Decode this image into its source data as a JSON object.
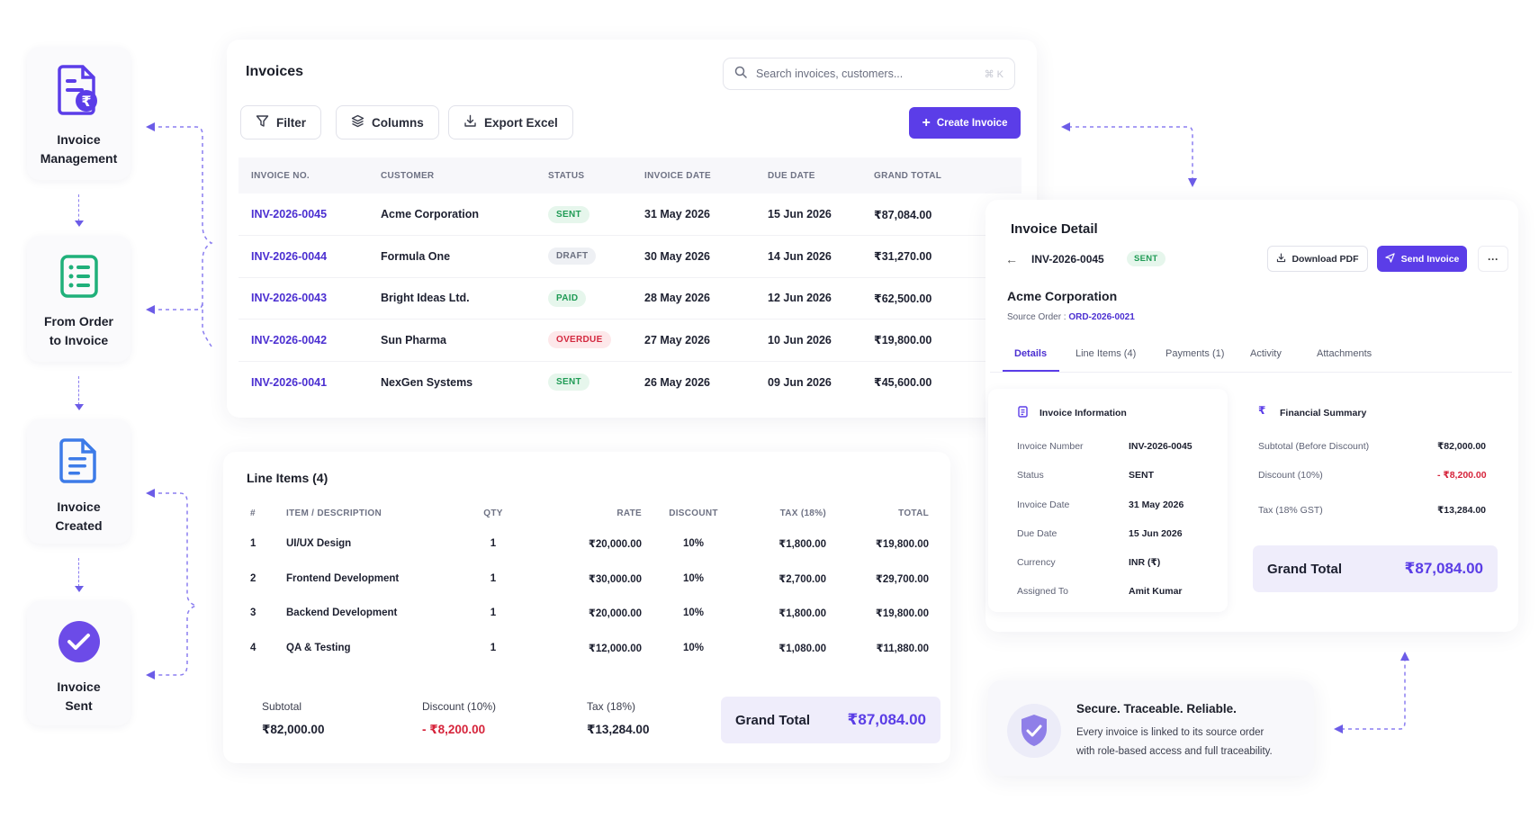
{
  "steps": [
    {
      "label": "Invoice\nManagement",
      "icon": "invoice-rupee-icon"
    },
    {
      "label": "From Order\nto Invoice",
      "icon": "order-list-icon"
    },
    {
      "label": "Invoice\nCreated",
      "icon": "document-icon"
    },
    {
      "label": "Invoice\nSent",
      "icon": "check-circle-icon"
    }
  ],
  "invoices": {
    "title": "Invoices",
    "search_placeholder": "Search invoices, customers...",
    "search_shortcut": "⌘ K",
    "filter": "Filter",
    "columns": "Columns",
    "export": "Export Excel",
    "create": "Create Invoice",
    "headers": [
      "INVOICE NO.",
      "CUSTOMER",
      "STATUS",
      "INVOICE DATE",
      "DUE DATE",
      "GRAND TOTAL"
    ],
    "rows": [
      {
        "no": "INV-2026-0045",
        "customer": "Acme Corporation",
        "status": "SENT",
        "date": "31 May 2026",
        "due": "15 Jun 2026",
        "total": "₹87,084.00"
      },
      {
        "no": "INV-2026-0044",
        "customer": "Formula One",
        "status": "DRAFT",
        "date": "30 May 2026",
        "due": "14 Jun 2026",
        "total": "₹31,270.00"
      },
      {
        "no": "INV-2026-0043",
        "customer": "Bright Ideas Ltd.",
        "status": "PAID",
        "date": "28 May 2026",
        "due": "12 Jun 2026",
        "total": "₹62,500.00"
      },
      {
        "no": "INV-2026-0042",
        "customer": "Sun Pharma",
        "status": "OVERDUE",
        "date": "27 May 2026",
        "due": "10 Jun 2026",
        "total": "₹19,800.00"
      },
      {
        "no": "INV-2026-0041",
        "customer": "NexGen Systems",
        "status": "SENT",
        "date": "26 May 2026",
        "due": "09 Jun 2026",
        "total": "₹45,600.00"
      }
    ]
  },
  "line_items": {
    "title": "Line Items (4)",
    "headers": [
      "#",
      "ITEM / DESCRIPTION",
      "QTY",
      "RATE",
      "DISCOUNT",
      "TAX (18%)",
      "TOTAL"
    ],
    "rows": [
      {
        "n": "1",
        "item": "UI/UX Design",
        "qty": "1",
        "rate": "₹20,000.00",
        "disc": "10%",
        "tax": "₹1,800.00",
        "total": "₹19,800.00"
      },
      {
        "n": "2",
        "item": "Frontend Development",
        "qty": "1",
        "rate": "₹30,000.00",
        "disc": "10%",
        "tax": "₹2,700.00",
        "total": "₹29,700.00"
      },
      {
        "n": "3",
        "item": "Backend Development",
        "qty": "1",
        "rate": "₹20,000.00",
        "disc": "10%",
        "tax": "₹1,800.00",
        "total": "₹19,800.00"
      },
      {
        "n": "4",
        "item": "QA & Testing",
        "qty": "1",
        "rate": "₹12,000.00",
        "disc": "10%",
        "tax": "₹1,080.00",
        "total": "₹11,880.00"
      }
    ],
    "subtotal_label": "Subtotal",
    "subtotal": "₹82,000.00",
    "discount_label": "Discount (10%)",
    "discount": "- ₹8,200.00",
    "tax_label": "Tax (18%)",
    "tax": "₹13,284.00",
    "grand_label": "Grand Total",
    "grand": "₹87,084.00"
  },
  "detail": {
    "title": "Invoice Detail",
    "invoice_no": "INV-2026-0045",
    "status": "SENT",
    "download": "Download PDF",
    "send": "Send Invoice",
    "more": "···",
    "customer": "Acme Corporation",
    "source_label": "Source Order :",
    "source_order": "ORD-2026-0021",
    "tabs": [
      "Details",
      "Line Items (4)",
      "Payments (1)",
      "Activity",
      "Attachments"
    ],
    "info_title": "Invoice Information",
    "info": [
      {
        "k": "Invoice Number",
        "v": "INV-2026-0045"
      },
      {
        "k": "Status",
        "v": "SENT"
      },
      {
        "k": "Invoice Date",
        "v": "31 May 2026"
      },
      {
        "k": "Due Date",
        "v": "15 Jun 2026"
      },
      {
        "k": "Currency",
        "v": "INR (₹)"
      },
      {
        "k": "Assigned To",
        "v": "Amit Kumar"
      }
    ],
    "fin_title": "Financial Summary",
    "fin": [
      {
        "k": "Subtotal (Before Discount)",
        "v": "₹82,000.00"
      },
      {
        "k": "Discount (10%)",
        "v": "- ₹8,200.00"
      },
      {
        "k": "Tax (18% GST)",
        "v": "₹13,284.00"
      }
    ],
    "grand_label": "Grand Total",
    "grand": "₹87,084.00"
  },
  "secure": {
    "title": "Secure. Traceable. Reliable.",
    "line1": "Every invoice is linked to its source order",
    "line2": "with role-based access and full traceability."
  },
  "colors": {
    "accent": "#5b3de8",
    "success": "#1f9b55",
    "danger": "#d3283f"
  }
}
